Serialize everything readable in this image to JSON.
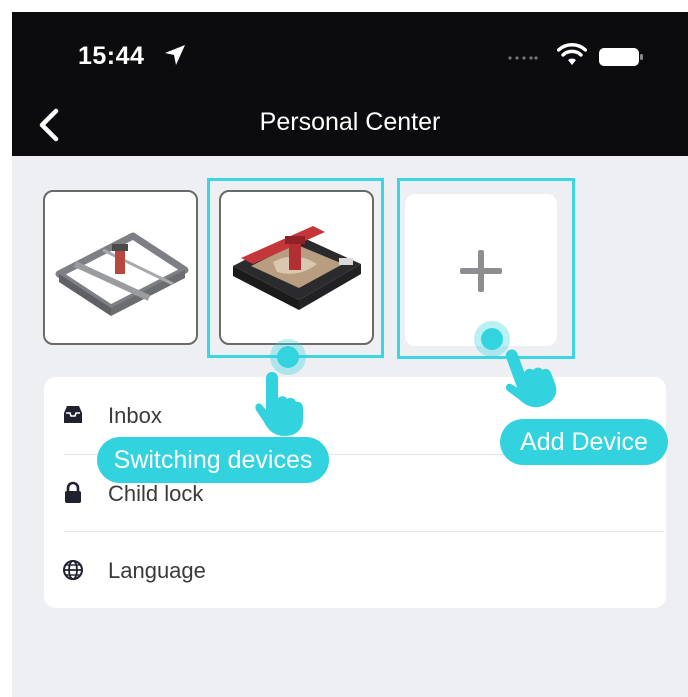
{
  "status_bar": {
    "time": "15:44"
  },
  "nav": {
    "title": "Personal Center"
  },
  "devices": [
    {
      "name": "laser-engraver-open-frame"
    },
    {
      "name": "laser-engraver-enclosed"
    }
  ],
  "add_device": {
    "symbol": "+"
  },
  "menu": {
    "items": [
      {
        "label": "Inbox",
        "icon": "inbox-icon"
      },
      {
        "label": "Child lock",
        "icon": "lock-icon"
      },
      {
        "label": "Language",
        "icon": "globe-icon"
      }
    ]
  },
  "tutorial": {
    "switch_label": "Switching devices",
    "add_label": "Add  Device"
  },
  "colors": {
    "accent": "#32d3df",
    "nav_background": "#0c0c0e",
    "page_background": "#eeeff3"
  }
}
